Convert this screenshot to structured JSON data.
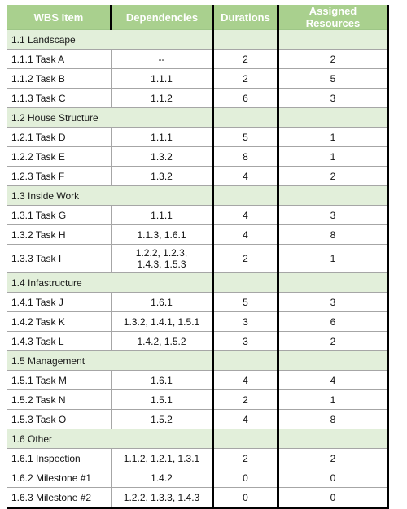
{
  "table": {
    "columns": [
      {
        "key": "wbs",
        "label": "WBS Item"
      },
      {
        "key": "dep",
        "label": "Dependencies"
      },
      {
        "key": "dur",
        "label": "Durations"
      },
      {
        "key": "res",
        "label": "Assigned Resources"
      }
    ],
    "colors": {
      "header_background": "#a9d08e",
      "header_text": "#ffffff",
      "group_row_background": "#e2efda",
      "body_background": "#ffffff",
      "body_text": "#111111",
      "thick_border": "#000000",
      "thin_border": "#a6a6a6"
    },
    "rows": [
      {
        "type": "group",
        "wbs": "1.1 Landscape",
        "dep": "",
        "dur": "",
        "res": ""
      },
      {
        "type": "task",
        "wbs": "1.1.1 Task A",
        "dep": "--",
        "dur": "2",
        "res": "2"
      },
      {
        "type": "task",
        "wbs": "1.1.2 Task B",
        "dep": "1.1.1",
        "dur": "2",
        "res": "5"
      },
      {
        "type": "task",
        "wbs": "1.1.3 Task C",
        "dep": "1.1.2",
        "dur": "6",
        "res": "3"
      },
      {
        "type": "group",
        "wbs": "1.2 House Structure",
        "dep": "",
        "dur": "",
        "res": ""
      },
      {
        "type": "task",
        "wbs": "1.2.1 Task D",
        "dep": "1.1.1",
        "dur": "5",
        "res": "1"
      },
      {
        "type": "task",
        "wbs": "1.2.2 Task E",
        "dep": "1.3.2",
        "dur": "8",
        "res": "1"
      },
      {
        "type": "task",
        "wbs": "1.2.3 Task F",
        "dep": "1.3.2",
        "dur": "4",
        "res": "2"
      },
      {
        "type": "group",
        "wbs": "1.3 Inside Work",
        "dep": "",
        "dur": "",
        "res": ""
      },
      {
        "type": "task",
        "wbs": "1.3.1 Task G",
        "dep": "1.1.1",
        "dur": "4",
        "res": "3"
      },
      {
        "type": "task",
        "wbs": "1.3.2 Task H",
        "dep": "1.1.3, 1.6.1",
        "dur": "4",
        "res": "8"
      },
      {
        "type": "task",
        "wbs": "1.3.3 Task I",
        "dep": "1.2.2, 1.2.3,\n1.4.3, 1.5.3",
        "dur": "2",
        "res": "1",
        "tall": true
      },
      {
        "type": "group",
        "wbs": "1.4 Infastructure",
        "dep": "",
        "dur": "",
        "res": ""
      },
      {
        "type": "task",
        "wbs": "1.4.1 Task J",
        "dep": "1.6.1",
        "dur": "5",
        "res": "3"
      },
      {
        "type": "task",
        "wbs": "1.4.2 Task K",
        "dep": "1.3.2, 1.4.1, 1.5.1",
        "dur": "3",
        "res": "6"
      },
      {
        "type": "task",
        "wbs": "1.4.3 Task L",
        "dep": "1.4.2, 1.5.2",
        "dur": "3",
        "res": "2"
      },
      {
        "type": "group",
        "wbs": "1.5 Management",
        "dep": "",
        "dur": "",
        "res": ""
      },
      {
        "type": "task",
        "wbs": "1.5.1 Task M",
        "dep": "1.6.1",
        "dur": "4",
        "res": "4"
      },
      {
        "type": "task",
        "wbs": "1.5.2 Task N",
        "dep": "1.5.1",
        "dur": "2",
        "res": "1"
      },
      {
        "type": "task",
        "wbs": "1.5.3 Task O",
        "dep": "1.5.2",
        "dur": "4",
        "res": "8"
      },
      {
        "type": "group",
        "wbs": "1.6 Other",
        "dep": "",
        "dur": "",
        "res": ""
      },
      {
        "type": "task",
        "wbs": "1.6.1 Inspection",
        "dep": "1.1.2, 1.2.1, 1.3.1",
        "dur": "2",
        "res": "2"
      },
      {
        "type": "task",
        "wbs": "1.6.2 Milestone #1",
        "dep": "1.4.2",
        "dur": "0",
        "res": "0"
      },
      {
        "type": "task",
        "wbs": "1.6.3 Milestone #2",
        "dep": "1.2.2, 1.3.3, 1.4.3",
        "dur": "0",
        "res": "0"
      }
    ]
  }
}
